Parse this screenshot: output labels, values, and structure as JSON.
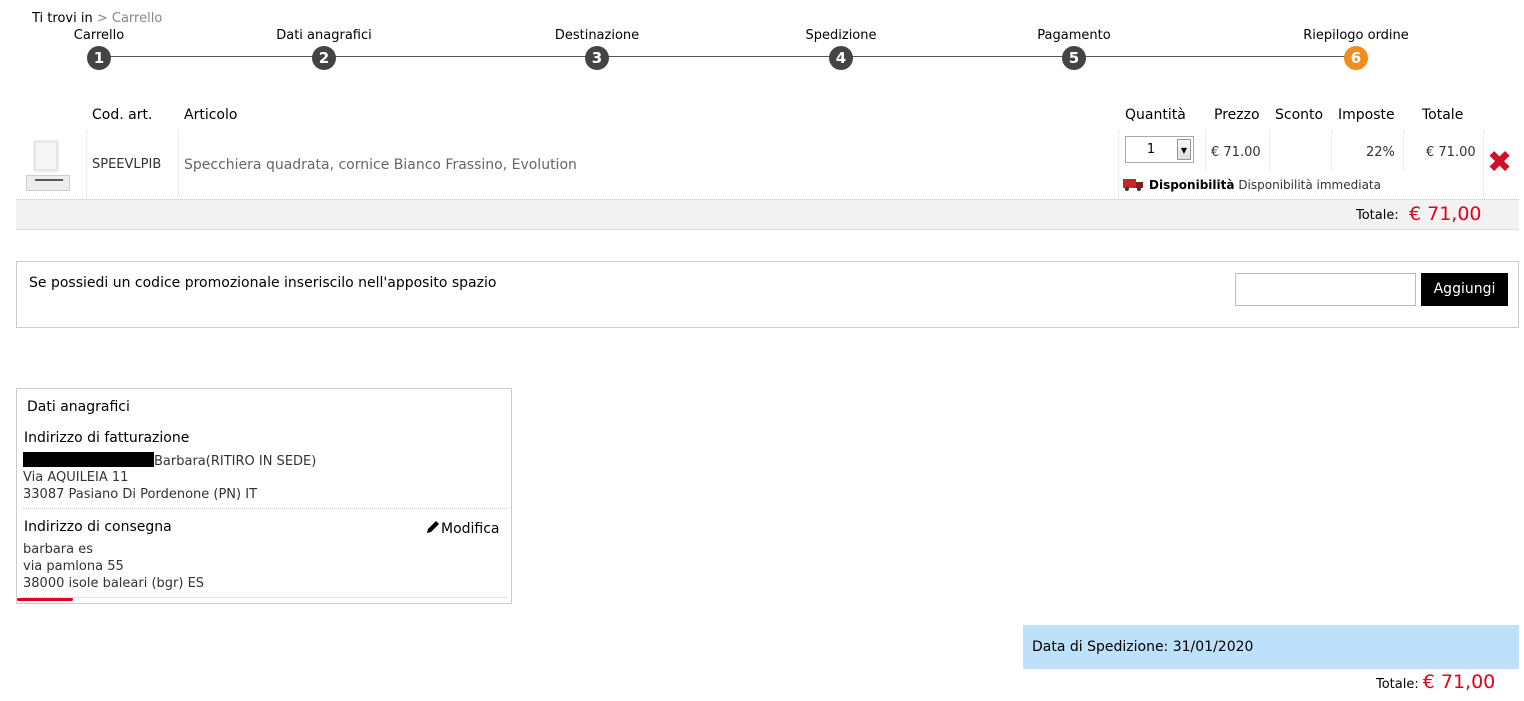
{
  "breadcrumb": {
    "prefix": "Ti trovi in",
    "sep": ">",
    "current": "Carrello"
  },
  "steps": [
    {
      "label": "Carrello",
      "num": "1"
    },
    {
      "label": "Dati anagrafici",
      "num": "2"
    },
    {
      "label": "Destinazione",
      "num": "3"
    },
    {
      "label": "Spedizione",
      "num": "4"
    },
    {
      "label": "Pagamento",
      "num": "5"
    },
    {
      "label": "Riepilogo ordine",
      "num": "6"
    }
  ],
  "cart": {
    "headers": {
      "code": "Cod. art.",
      "article": "Articolo",
      "qty": "Quantità",
      "price": "Prezzo",
      "discount": "Sconto",
      "vat": "Imposte",
      "total": "Totale"
    },
    "item": {
      "code": "SPEEVLPIB",
      "name": "Specchiera quadrata, cornice Bianco Frassino, Evolution",
      "qty": "1",
      "price": "€ 71.00",
      "discount": "",
      "vat": "22%",
      "total": "€ 71.00",
      "availability_label": "Disponibilità",
      "availability_value": "Disponibilità immediata"
    },
    "subtotal_label": "Totale:",
    "subtotal_value": "€ 71,00"
  },
  "promo": {
    "text": "Se possiedi un codice promozionale inseriscilo nell'apposito spazio",
    "input_value": "",
    "button": "Aggiungi"
  },
  "anagrafica": {
    "title": "Dati anagrafici",
    "billing_title": "Indirizzo di fatturazione",
    "billing_name": "Barbara(RITIRO IN SEDE)",
    "billing_street": "Via AQUILEIA 11",
    "billing_city": "33087 Pasiano Di Pordenone (PN) IT",
    "shipping_title": "Indirizzo di consegna",
    "edit_label": "Modifica",
    "shipping_name": "barbara es",
    "shipping_street": "via pamlona 55",
    "shipping_city": "38000 isole baleari (bgr) ES"
  },
  "shipping_date": "Data di Spedizione: 31/01/2020",
  "grand_total": {
    "label": "Totale:",
    "value": "€ 71,00"
  },
  "colors": {
    "accent_step": "#f28c1c",
    "price_red": "#e3001b",
    "date_bg": "#bde0fb"
  }
}
